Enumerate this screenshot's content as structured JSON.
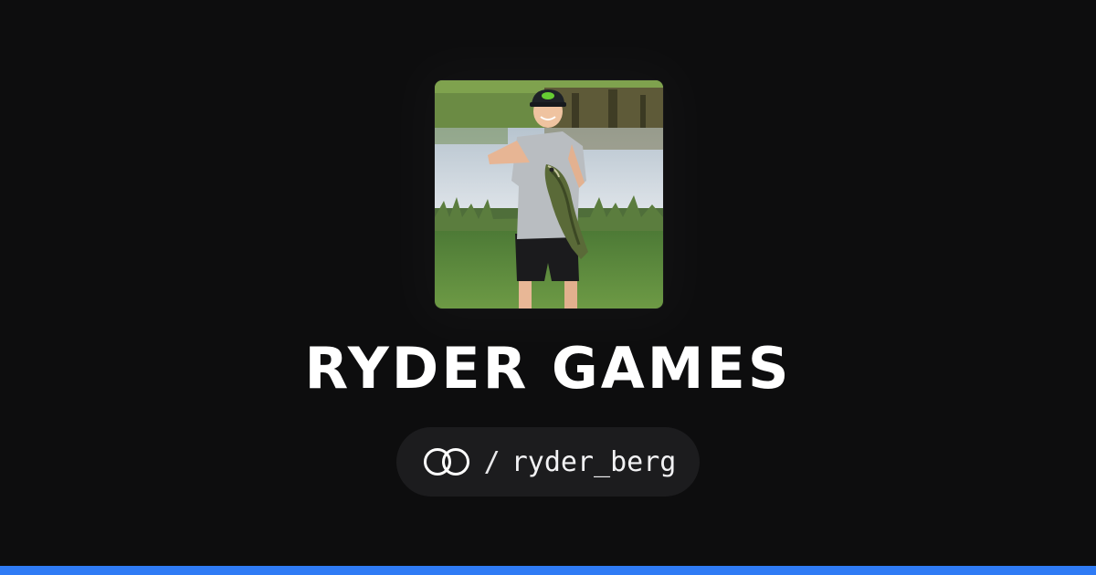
{
  "profile": {
    "display_name": "RYDER GAMES",
    "separator": "/",
    "handle": "ryder_berg",
    "platform_icon": "linked-rings-icon",
    "avatar_icon": "profile-photo"
  },
  "colors": {
    "background": "#0d0d0e",
    "pill_background": "#1c1c1e",
    "accent_bar": "#2f7bf5",
    "text": "#ffffff"
  }
}
